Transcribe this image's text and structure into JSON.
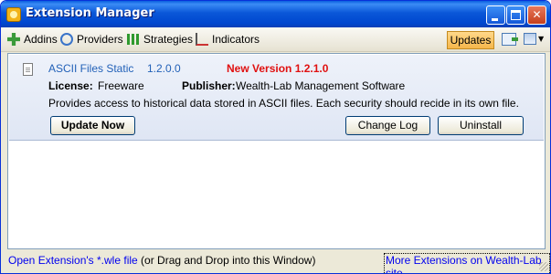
{
  "window": {
    "title": "Extension Manager"
  },
  "toolbar": {
    "items": [
      {
        "label": "Addins",
        "icon": "addins-icon"
      },
      {
        "label": "Providers",
        "icon": "providers-icon"
      },
      {
        "label": "Strategies",
        "icon": "strategies-icon"
      },
      {
        "label": "Indicators",
        "icon": "indicators-icon"
      }
    ],
    "updates_label": "Updates"
  },
  "extension": {
    "name": "ASCII Files Static",
    "version": "1.2.0.0",
    "new_version": "New Version 1.2.1.0",
    "license_label": "License:",
    "license_value": "Freeware",
    "publisher_label": "Publisher:",
    "publisher_value": "Wealth-Lab Management Software",
    "description": "Provides access to historical data stored in ASCII files. Each security should recide in its own file.",
    "update_button": "Update Now",
    "changelog_button": "Change Log",
    "uninstall_button": "Uninstall"
  },
  "footer": {
    "open_link": "Open Extension's *.wle file",
    "open_hint": " (or Drag and Drop into this Window)",
    "more_link": "More Extensions on Wealth-Lab site"
  },
  "colors": {
    "titlebar": "#0a57d8",
    "new_version": "#e01010",
    "link": "#0000ee",
    "accent_name": "#2261b8"
  }
}
